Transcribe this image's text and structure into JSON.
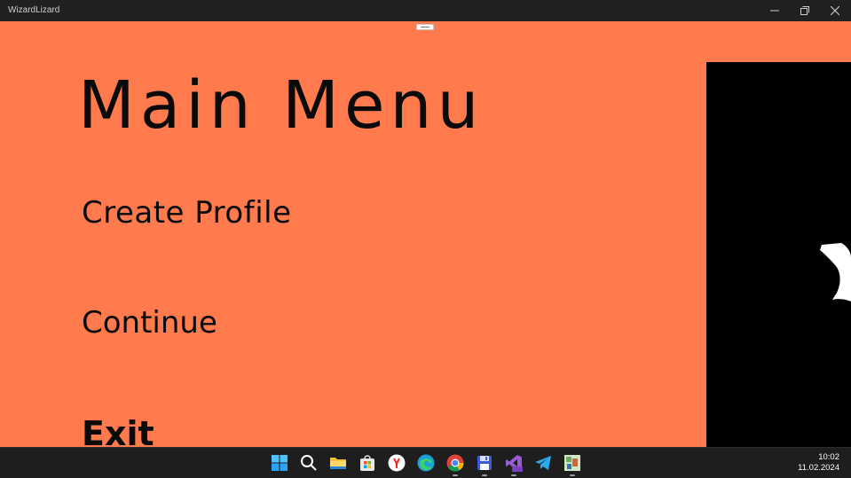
{
  "window": {
    "title": "WizardLizard",
    "controls": [
      "minimize",
      "restore",
      "close"
    ]
  },
  "menu": {
    "title": "Main Menu",
    "items": [
      "Create Profile",
      "Continue",
      "Exit"
    ]
  },
  "colors": {
    "background": "#ff7a4d",
    "text": "#0a0a0a",
    "preview_panel": "#000000",
    "taskbar": "#1e1e1e"
  },
  "taskbar": {
    "icons": [
      "windows-start-icon",
      "search-icon",
      "file-explorer-icon",
      "microsoft-store-icon",
      "yandex-browser-icon",
      "edge-icon",
      "chrome-icon",
      "save-disk-app-icon",
      "visual-studio-icon",
      "telegram-icon",
      "game-app-icon"
    ],
    "time": "10:02",
    "date": "11.02.2024"
  }
}
